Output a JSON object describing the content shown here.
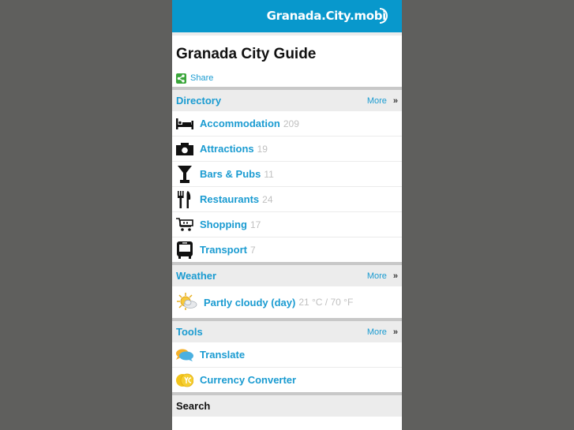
{
  "header": {
    "logo_text": "Granada.City.mobi"
  },
  "page_title": "Granada City Guide",
  "share": {
    "label": "Share",
    "icon": "share-icon",
    "color": "#3aa63a"
  },
  "colors": {
    "accent": "#1a9bd1",
    "topbar": "#0898cc",
    "section_bg": "#ececec",
    "count": "#c0c0c0"
  },
  "directory": {
    "title": "Directory",
    "more_label": "More",
    "more_glyph": "»",
    "items": [
      {
        "label": "Accommodation",
        "count": "209",
        "icon": "bed-icon"
      },
      {
        "label": "Attractions",
        "count": "19",
        "icon": "camera-icon"
      },
      {
        "label": "Bars & Pubs",
        "count": "11",
        "icon": "glass-icon"
      },
      {
        "label": "Restaurants",
        "count": "24",
        "icon": "fork-knife-icon"
      },
      {
        "label": "Shopping",
        "count": "17",
        "icon": "cart-icon"
      },
      {
        "label": "Transport",
        "count": "7",
        "icon": "bus-icon"
      }
    ]
  },
  "weather": {
    "title": "Weather",
    "more_label": "More",
    "more_glyph": "»",
    "condition": "Partly cloudy (day)",
    "temperature": "21 °C / 70 °F",
    "icon": "partly-cloudy-icon"
  },
  "tools": {
    "title": "Tools",
    "more_label": "More",
    "more_glyph": "»",
    "items": [
      {
        "label": "Translate",
        "icon": "speech-bubbles-icon"
      },
      {
        "label": "Currency Converter",
        "icon": "coins-icon"
      }
    ]
  },
  "search": {
    "title": "Search"
  }
}
